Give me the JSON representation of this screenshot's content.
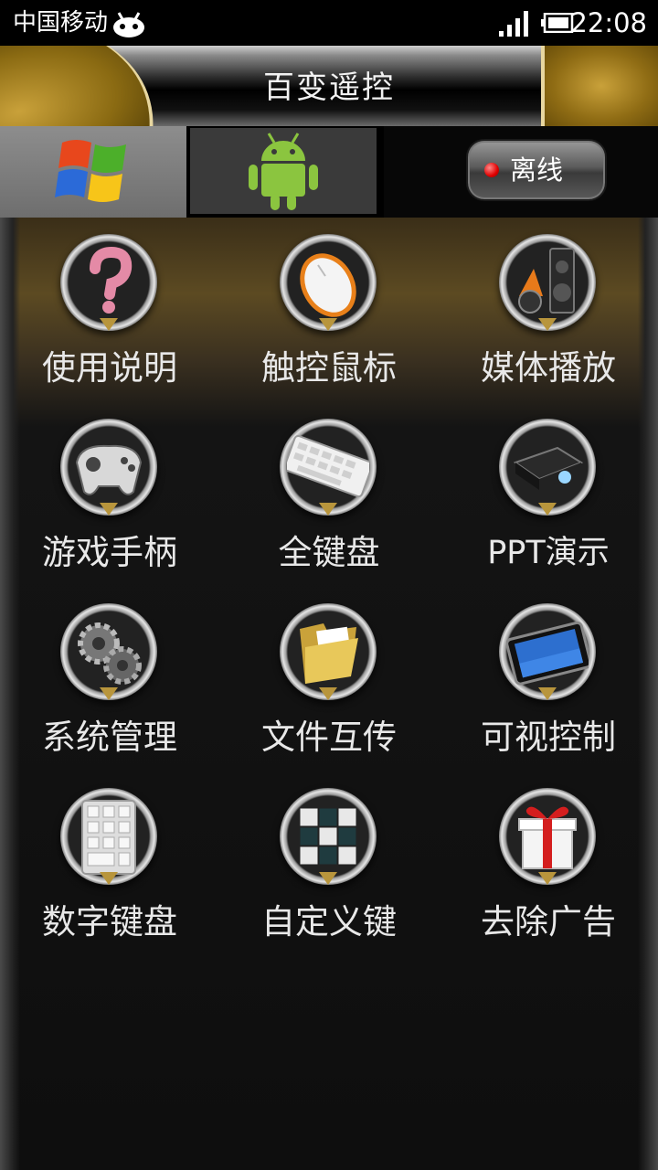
{
  "status_bar": {
    "carrier": "中国移动",
    "time": "22:08",
    "notification_icon": "android-robot-icon",
    "signal_icon": "signal-icon",
    "battery_icon": "battery-icon"
  },
  "header": {
    "title": "百变遥控"
  },
  "tabs": {
    "windows_icon": "windows-logo-icon",
    "android_icon": "android-logo-icon",
    "connection_status": "离线",
    "status_color": "#e00000"
  },
  "features": [
    {
      "label": "使用说明",
      "icon": "help-icon"
    },
    {
      "label": "触控鼠标",
      "icon": "mouse-icon"
    },
    {
      "label": "媒体播放",
      "icon": "media-speaker-icon"
    },
    {
      "label": "游戏手柄",
      "icon": "gamepad-icon"
    },
    {
      "label": "全键盘",
      "icon": "keyboard-icon"
    },
    {
      "label": "PPT演示",
      "icon": "projector-icon"
    },
    {
      "label": "系统管理",
      "icon": "gears-icon"
    },
    {
      "label": "文件互传",
      "icon": "folder-icon"
    },
    {
      "label": "可视控制",
      "icon": "tablet-icon"
    },
    {
      "label": "数字键盘",
      "icon": "numpad-icon"
    },
    {
      "label": "自定义键",
      "icon": "cube-icon"
    },
    {
      "label": "去除广告",
      "icon": "gift-icon"
    }
  ],
  "colors": {
    "accent_gold": "#c9a13a",
    "background": "#0e0e0e"
  }
}
